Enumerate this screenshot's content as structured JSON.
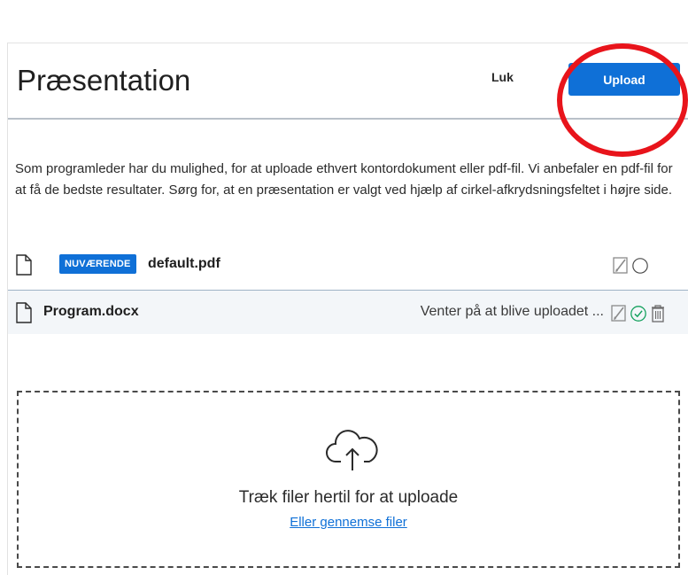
{
  "header": {
    "title": "Præsentation",
    "close_label": "Luk",
    "upload_label": "Upload"
  },
  "description": "Som programleder har du mulighed, for at uploade ethvert kontordokument eller pdf-fil. Vi anbefaler en pdf-fil for at få de bedste resultater. Sørg for, at en præsentation er valgt ved hjælp af cirkel-afkrydsningsfeltet i højre side.",
  "files": [
    {
      "badge": "NUVÆRENDE",
      "name": "default.pdf",
      "status": "",
      "selected": false,
      "icons": [
        "document-icon",
        "edit-disabled-icon",
        "radio-unselected-icon"
      ]
    },
    {
      "badge": "",
      "name": "Program.docx",
      "status": "Venter på at blive uploadet ...",
      "selected": true,
      "icons": [
        "document-icon",
        "edit-disabled-icon",
        "check-circle-icon",
        "trash-icon"
      ]
    }
  ],
  "dropzone": {
    "text": "Træk filer hertil for at uploade",
    "browse_label": "Eller gennemse filer",
    "icon": "cloud-upload-icon"
  },
  "colors": {
    "primary": "#0f70d7",
    "highlight": "#e8141b",
    "success": "#12a05c"
  }
}
